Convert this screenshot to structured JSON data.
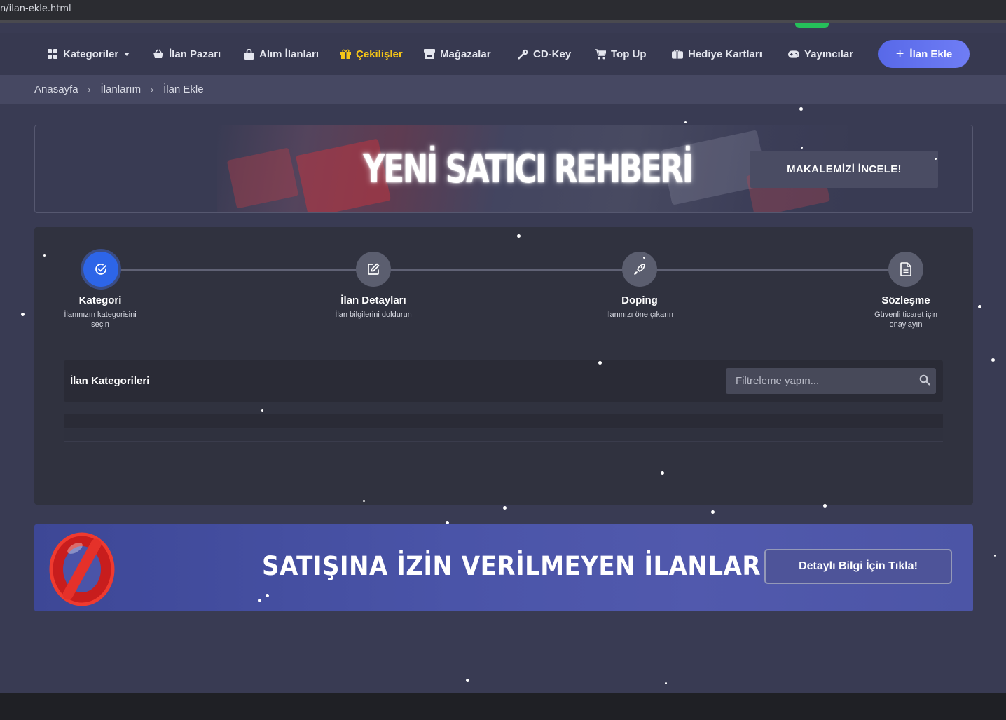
{
  "browser": {
    "url": "n/ilan-ekle.html"
  },
  "nav": {
    "items": [
      {
        "label": "Kategoriler",
        "icon": "grid-icon"
      },
      {
        "label": "İlan Pazarı",
        "icon": "basket-icon"
      },
      {
        "label": "Alım İlanları",
        "icon": "bag-icon"
      },
      {
        "label": "Çekilişler",
        "icon": "gift-icon"
      },
      {
        "label": "Mağazalar",
        "icon": "store-icon"
      },
      {
        "label": "CD-Key",
        "icon": "key-icon"
      },
      {
        "label": "Top Up",
        "icon": "cart-icon"
      },
      {
        "label": "Hediye Kartları",
        "icon": "giftcard-icon"
      },
      {
        "label": "Yayıncılar",
        "icon": "gamepad-icon"
      }
    ],
    "add_button": "İlan Ekle"
  },
  "breadcrumb": [
    "Anasayfa",
    "İlanlarım",
    "İlan Ekle"
  ],
  "guide_banner": {
    "title": "YENİ SATICI REHBERİ",
    "button": "MAKALEMİZİ İNCELE!"
  },
  "steps": [
    {
      "title": "Kategori",
      "desc": "İlanınızın kategorisini seçin",
      "icon": "check-circle-icon"
    },
    {
      "title": "İlan Detayları",
      "desc": "İlan bilgilerini doldurun",
      "icon": "edit-icon"
    },
    {
      "title": "Doping",
      "desc": "İlanınızı öne çıkarın",
      "icon": "rocket-icon"
    },
    {
      "title": "Sözleşme",
      "desc": "Güvenli ticaret için onaylayın",
      "icon": "document-icon"
    }
  ],
  "categories": {
    "title": "İlan Kategorileri",
    "filter_placeholder": "Filtreleme yapın..."
  },
  "forbidden_banner": {
    "title": "SATIŞINA İZİN VERİLMEYEN İLANLAR",
    "button": "Detaylı Bilgi İçin Tıkla!"
  },
  "colors": {
    "accent": "#2d65e8",
    "active_nav": "#f5c518",
    "page_bg": "#393b53"
  }
}
